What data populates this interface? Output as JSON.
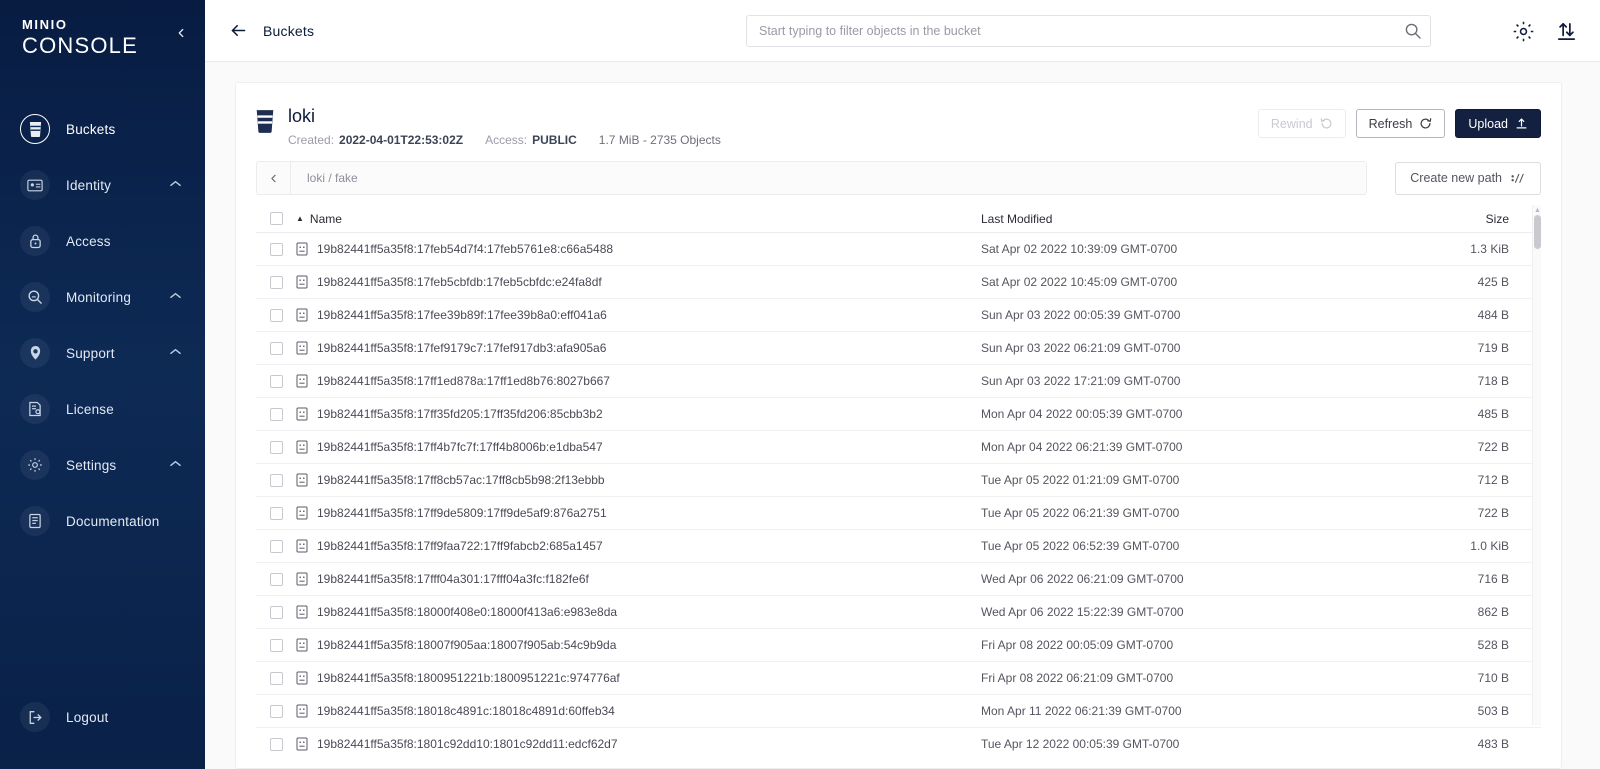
{
  "sidebar": {
    "brand_top": "MINIO",
    "brand_bottom": "CONSOLE",
    "collapse_icon": "chevron-left-icon",
    "items": [
      {
        "label": "Buckets",
        "icon": "bucket-icon",
        "active": true,
        "expandable": false
      },
      {
        "label": "Identity",
        "icon": "id-card-icon",
        "active": false,
        "expandable": true
      },
      {
        "label": "Access",
        "icon": "lock-icon",
        "active": false,
        "expandable": false
      },
      {
        "label": "Monitoring",
        "icon": "magnifier-icon",
        "active": false,
        "expandable": true
      },
      {
        "label": "Support",
        "icon": "support-icon",
        "active": false,
        "expandable": true
      },
      {
        "label": "License",
        "icon": "license-icon",
        "active": false,
        "expandable": false
      },
      {
        "label": "Settings",
        "icon": "gear-icon",
        "active": false,
        "expandable": true
      },
      {
        "label": "Documentation",
        "icon": "document-icon",
        "active": false,
        "expandable": false
      }
    ],
    "logout": {
      "label": "Logout",
      "icon": "logout-icon"
    }
  },
  "topbar": {
    "back_icon": "arrow-left-icon",
    "title": "Buckets",
    "search_placeholder": "Start typing to filter objects in the bucket",
    "search_value": "",
    "search_icon": "search-icon",
    "settings_icon": "gear-icon",
    "transfer_icon": "upload-download-icon"
  },
  "bucket": {
    "icon": "bucket-icon",
    "name": "loki",
    "created_label": "Created:",
    "created_value": "2022-04-01T22:53:02Z",
    "access_label": "Access:",
    "access_value": "PUBLIC",
    "size_objects": "1.7 MiB - 2735 Objects",
    "actions": {
      "rewind": "Rewind",
      "refresh": "Refresh",
      "upload": "Upload"
    }
  },
  "path": {
    "back_icon": "chevron-left-icon",
    "breadcrumb": "loki / fake",
    "create_new_path": "Create new path"
  },
  "table": {
    "columns": {
      "name": "Name",
      "last_modified": "Last Modified",
      "size": "Size"
    },
    "sort_direction": "asc",
    "rows": [
      {
        "name": "19b82441ff5a35f8:17feb54d7f4:17feb5761e8:c66a5488",
        "modified": "Sat Apr 02 2022 10:39:09 GMT-0700",
        "size": "1.3 KiB"
      },
      {
        "name": "19b82441ff5a35f8:17feb5cbfdb:17feb5cbfdc:e24fa8df",
        "modified": "Sat Apr 02 2022 10:45:09 GMT-0700",
        "size": "425 B"
      },
      {
        "name": "19b82441ff5a35f8:17fee39b89f:17fee39b8a0:eff041a6",
        "modified": "Sun Apr 03 2022 00:05:39 GMT-0700",
        "size": "484 B"
      },
      {
        "name": "19b82441ff5a35f8:17fef9179c7:17fef917db3:afa905a6",
        "modified": "Sun Apr 03 2022 06:21:09 GMT-0700",
        "size": "719 B"
      },
      {
        "name": "19b82441ff5a35f8:17ff1ed878a:17ff1ed8b76:8027b667",
        "modified": "Sun Apr 03 2022 17:21:09 GMT-0700",
        "size": "718 B"
      },
      {
        "name": "19b82441ff5a35f8:17ff35fd205:17ff35fd206:85cbb3b2",
        "modified": "Mon Apr 04 2022 00:05:39 GMT-0700",
        "size": "485 B"
      },
      {
        "name": "19b82441ff5a35f8:17ff4b7fc7f:17ff4b8006b:e1dba547",
        "modified": "Mon Apr 04 2022 06:21:39 GMT-0700",
        "size": "722 B"
      },
      {
        "name": "19b82441ff5a35f8:17ff8cb57ac:17ff8cb5b98:2f13ebbb",
        "modified": "Tue Apr 05 2022 01:21:09 GMT-0700",
        "size": "712 B"
      },
      {
        "name": "19b82441ff5a35f8:17ff9de5809:17ff9de5af9:876a2751",
        "modified": "Tue Apr 05 2022 06:21:39 GMT-0700",
        "size": "722 B"
      },
      {
        "name": "19b82441ff5a35f8:17ff9faa722:17ff9fabcb2:685a1457",
        "modified": "Tue Apr 05 2022 06:52:39 GMT-0700",
        "size": "1.0 KiB"
      },
      {
        "name": "19b82441ff5a35f8:17fff04a301:17fff04a3fc:f182fe6f",
        "modified": "Wed Apr 06 2022 06:21:09 GMT-0700",
        "size": "716 B"
      },
      {
        "name": "19b82441ff5a35f8:18000f408e0:18000f413a6:e983e8da",
        "modified": "Wed Apr 06 2022 15:22:39 GMT-0700",
        "size": "862 B"
      },
      {
        "name": "19b82441ff5a35f8:18007f905aa:18007f905ab:54c9b9da",
        "modified": "Fri Apr 08 2022 00:05:09 GMT-0700",
        "size": "528 B"
      },
      {
        "name": "19b82441ff5a35f8:1800951221b:1800951221c:974776af",
        "modified": "Fri Apr 08 2022 06:21:09 GMT-0700",
        "size": "710 B"
      },
      {
        "name": "19b82441ff5a35f8:18018c4891c:18018c4891d:60ffeb34",
        "modified": "Mon Apr 11 2022 06:21:39 GMT-0700",
        "size": "503 B"
      },
      {
        "name": "19b82441ff5a35f8:1801c92dd10:1801c92dd11:edcf62d7",
        "modified": "Tue Apr 12 2022 00:05:39 GMT-0700",
        "size": "483 B"
      }
    ]
  },
  "colors": {
    "sidebar_dark": "#081c42",
    "primary": "#13203f",
    "text": "#0b1b38",
    "muted": "#868692"
  }
}
